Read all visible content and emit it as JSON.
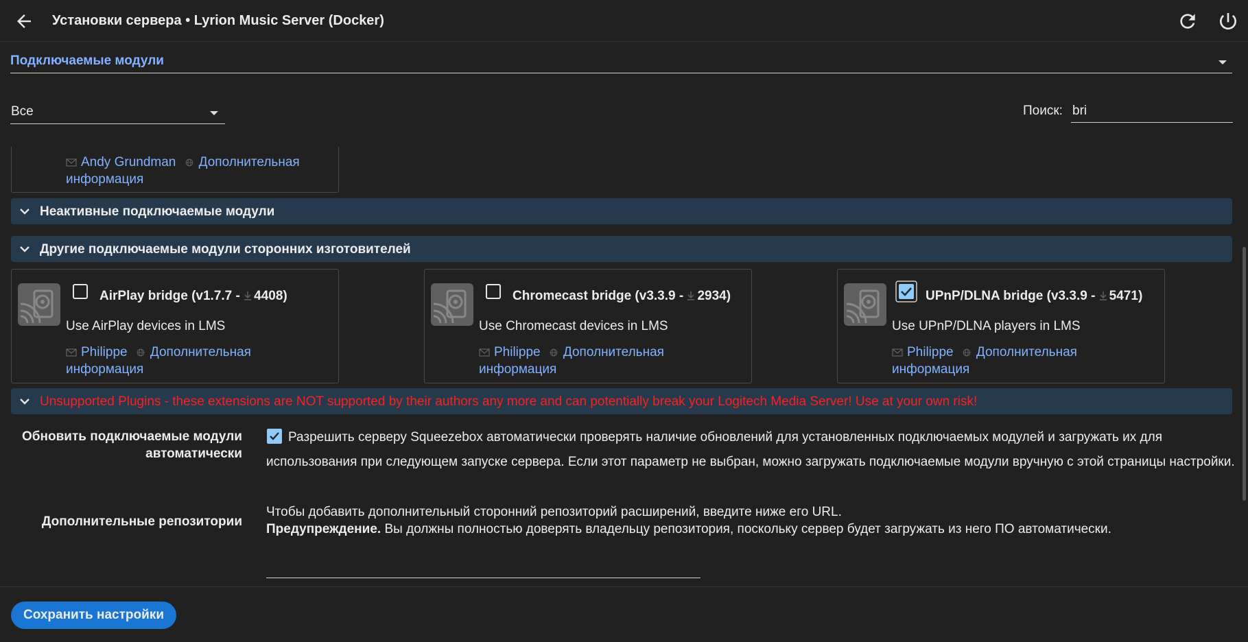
{
  "header": {
    "title": "Установки сервера • Lyrion Music Server (Docker)",
    "back_icon": "arrow-left-icon",
    "refresh_icon": "refresh-icon",
    "power_icon": "power-icon"
  },
  "section": {
    "selected": "Подключаемые модули"
  },
  "filter": {
    "selected": "Все"
  },
  "search": {
    "label": "Поиск:",
    "value": "bri"
  },
  "partial_card": {
    "author": "Andy Grundman",
    "more_line1": "Дополнительная",
    "more_line2": "информация"
  },
  "groups": {
    "inactive": "Неактивные подключаемые модули",
    "third_party": "Другие подключаемые модули сторонних изготовителей",
    "unsupported": "Unsupported Plugins - these extensions are NOT supported by their authors any more and can potentially break your Logitech Media Server! Use at your own risk!"
  },
  "plugins": [
    {
      "name": "AirPlay bridge (v1.7.7 - ",
      "downloads": "4408)",
      "description": "Use AirPlay devices in LMS",
      "author": "Philippe",
      "more_line1": "Дополнительная",
      "more_line2": "информация",
      "checked": false
    },
    {
      "name": "Chromecast bridge (v3.3.9 - ",
      "downloads": "2934)",
      "description": "Use Chromecast devices in LMS",
      "author": "Philippe",
      "more_line1": "Дополнительная",
      "more_line2": "информация",
      "checked": false
    },
    {
      "name": "UPnP/DLNA bridge (v3.3.9 - ",
      "downloads": "5471)",
      "description": "Use UPnP/DLNA players in LMS",
      "author": "Philippe",
      "more_line1": "Дополнительная",
      "more_line2": "информация",
      "checked": true
    }
  ],
  "auto_update": {
    "label_line1": "Обновить подключаемые модули",
    "label_line2": "автоматически",
    "text": "Разрешить серверу Squeezebox автоматически проверять наличие обновлений для установленных подключаемых модулей и загружать их для использования при следующем запуске сервера. Если этот параметр не выбран, можно загружать подключаемые модули вручную с этой страницы настройки.",
    "checked": true
  },
  "repos": {
    "label": "Дополнительные репозитории",
    "intro": "Чтобы добавить дополнительный сторонний репозиторий расширений, введите ниже его URL.",
    "warning_bold": "Предупреждение.",
    "warning_text": " Вы должны полностью доверять владельцу репозитория, поскольку сервер будет загружать из него ПО автоматически."
  },
  "save_button": "Сохранить настройки",
  "colors": {
    "accent": "#82b1ff",
    "group_bg": "#263a4e",
    "danger": "#ff1f1f",
    "button": "#1976d2"
  }
}
